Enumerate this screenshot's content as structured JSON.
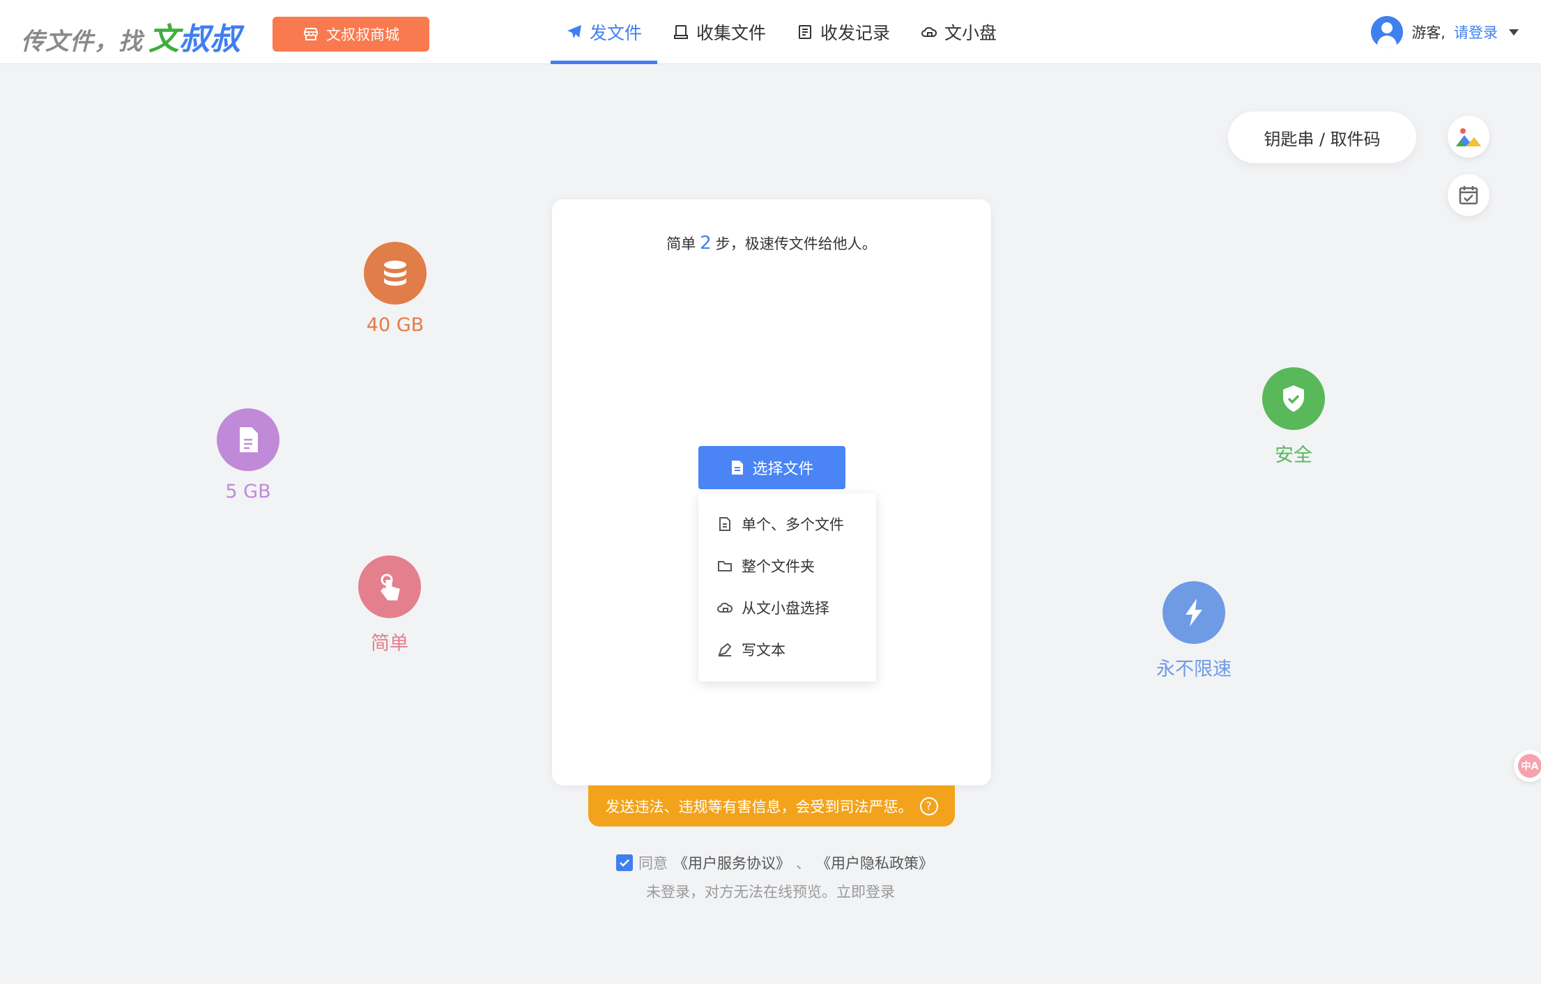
{
  "header": {
    "logo_prefix": "传文件，找",
    "logo_brand_1": "文",
    "logo_brand_2": "叔叔",
    "mall_button": "文叔叔商城",
    "nav": [
      {
        "label": "发文件",
        "icon": "paper-plane-icon",
        "active": true
      },
      {
        "label": "收集文件",
        "icon": "inbox-icon",
        "active": false
      },
      {
        "label": "收发记录",
        "icon": "record-list-icon",
        "active": false
      },
      {
        "label": "文小盘",
        "icon": "cloud-lock-icon",
        "active": false
      }
    ],
    "user": {
      "guest_label": "游客,",
      "login_label": "请登录"
    }
  },
  "right_tools": {
    "key_code_label": "钥匙串 / 取件码"
  },
  "features": [
    {
      "label": "40 GB",
      "icon": "database-icon",
      "color": "#e07d48"
    },
    {
      "label": "5 GB",
      "icon": "document-icon",
      "color": "#c08ad8"
    },
    {
      "label": "简单",
      "icon": "tap-hand-icon",
      "color": "#e47f8e"
    },
    {
      "label": "安全",
      "icon": "shield-check-icon",
      "color": "#59b85a"
    },
    {
      "label": "永不限速",
      "icon": "lightning-icon",
      "color": "#6e9be3"
    }
  ],
  "card": {
    "tip_prefix": "简单",
    "tip_number": "2",
    "tip_suffix": "步，极速传文件给他人。",
    "select_button": "选择文件"
  },
  "dropdown": [
    {
      "label": "单个、多个文件",
      "icon": "file-icon"
    },
    {
      "label": "整个文件夹",
      "icon": "folder-icon"
    },
    {
      "label": "从文小盘选择",
      "icon": "cloud-icon"
    },
    {
      "label": "写文本",
      "icon": "pen-icon"
    }
  ],
  "warning": {
    "text": "发送违法、违规等有害信息，会受到司法严惩。",
    "help": "?"
  },
  "agreement": {
    "agree_label": "同意",
    "service_link": "《用户服务协议》",
    "separator": "、",
    "privacy_link": "《用户隐私政策》"
  },
  "login_hint": {
    "text": "未登录，对方无法在线预览。",
    "action": "立即登录"
  },
  "translate_badge": "中A",
  "colors": {
    "accent": "#3f7ff0",
    "mall": "#f97a4e",
    "warning": "#f2a31b"
  }
}
